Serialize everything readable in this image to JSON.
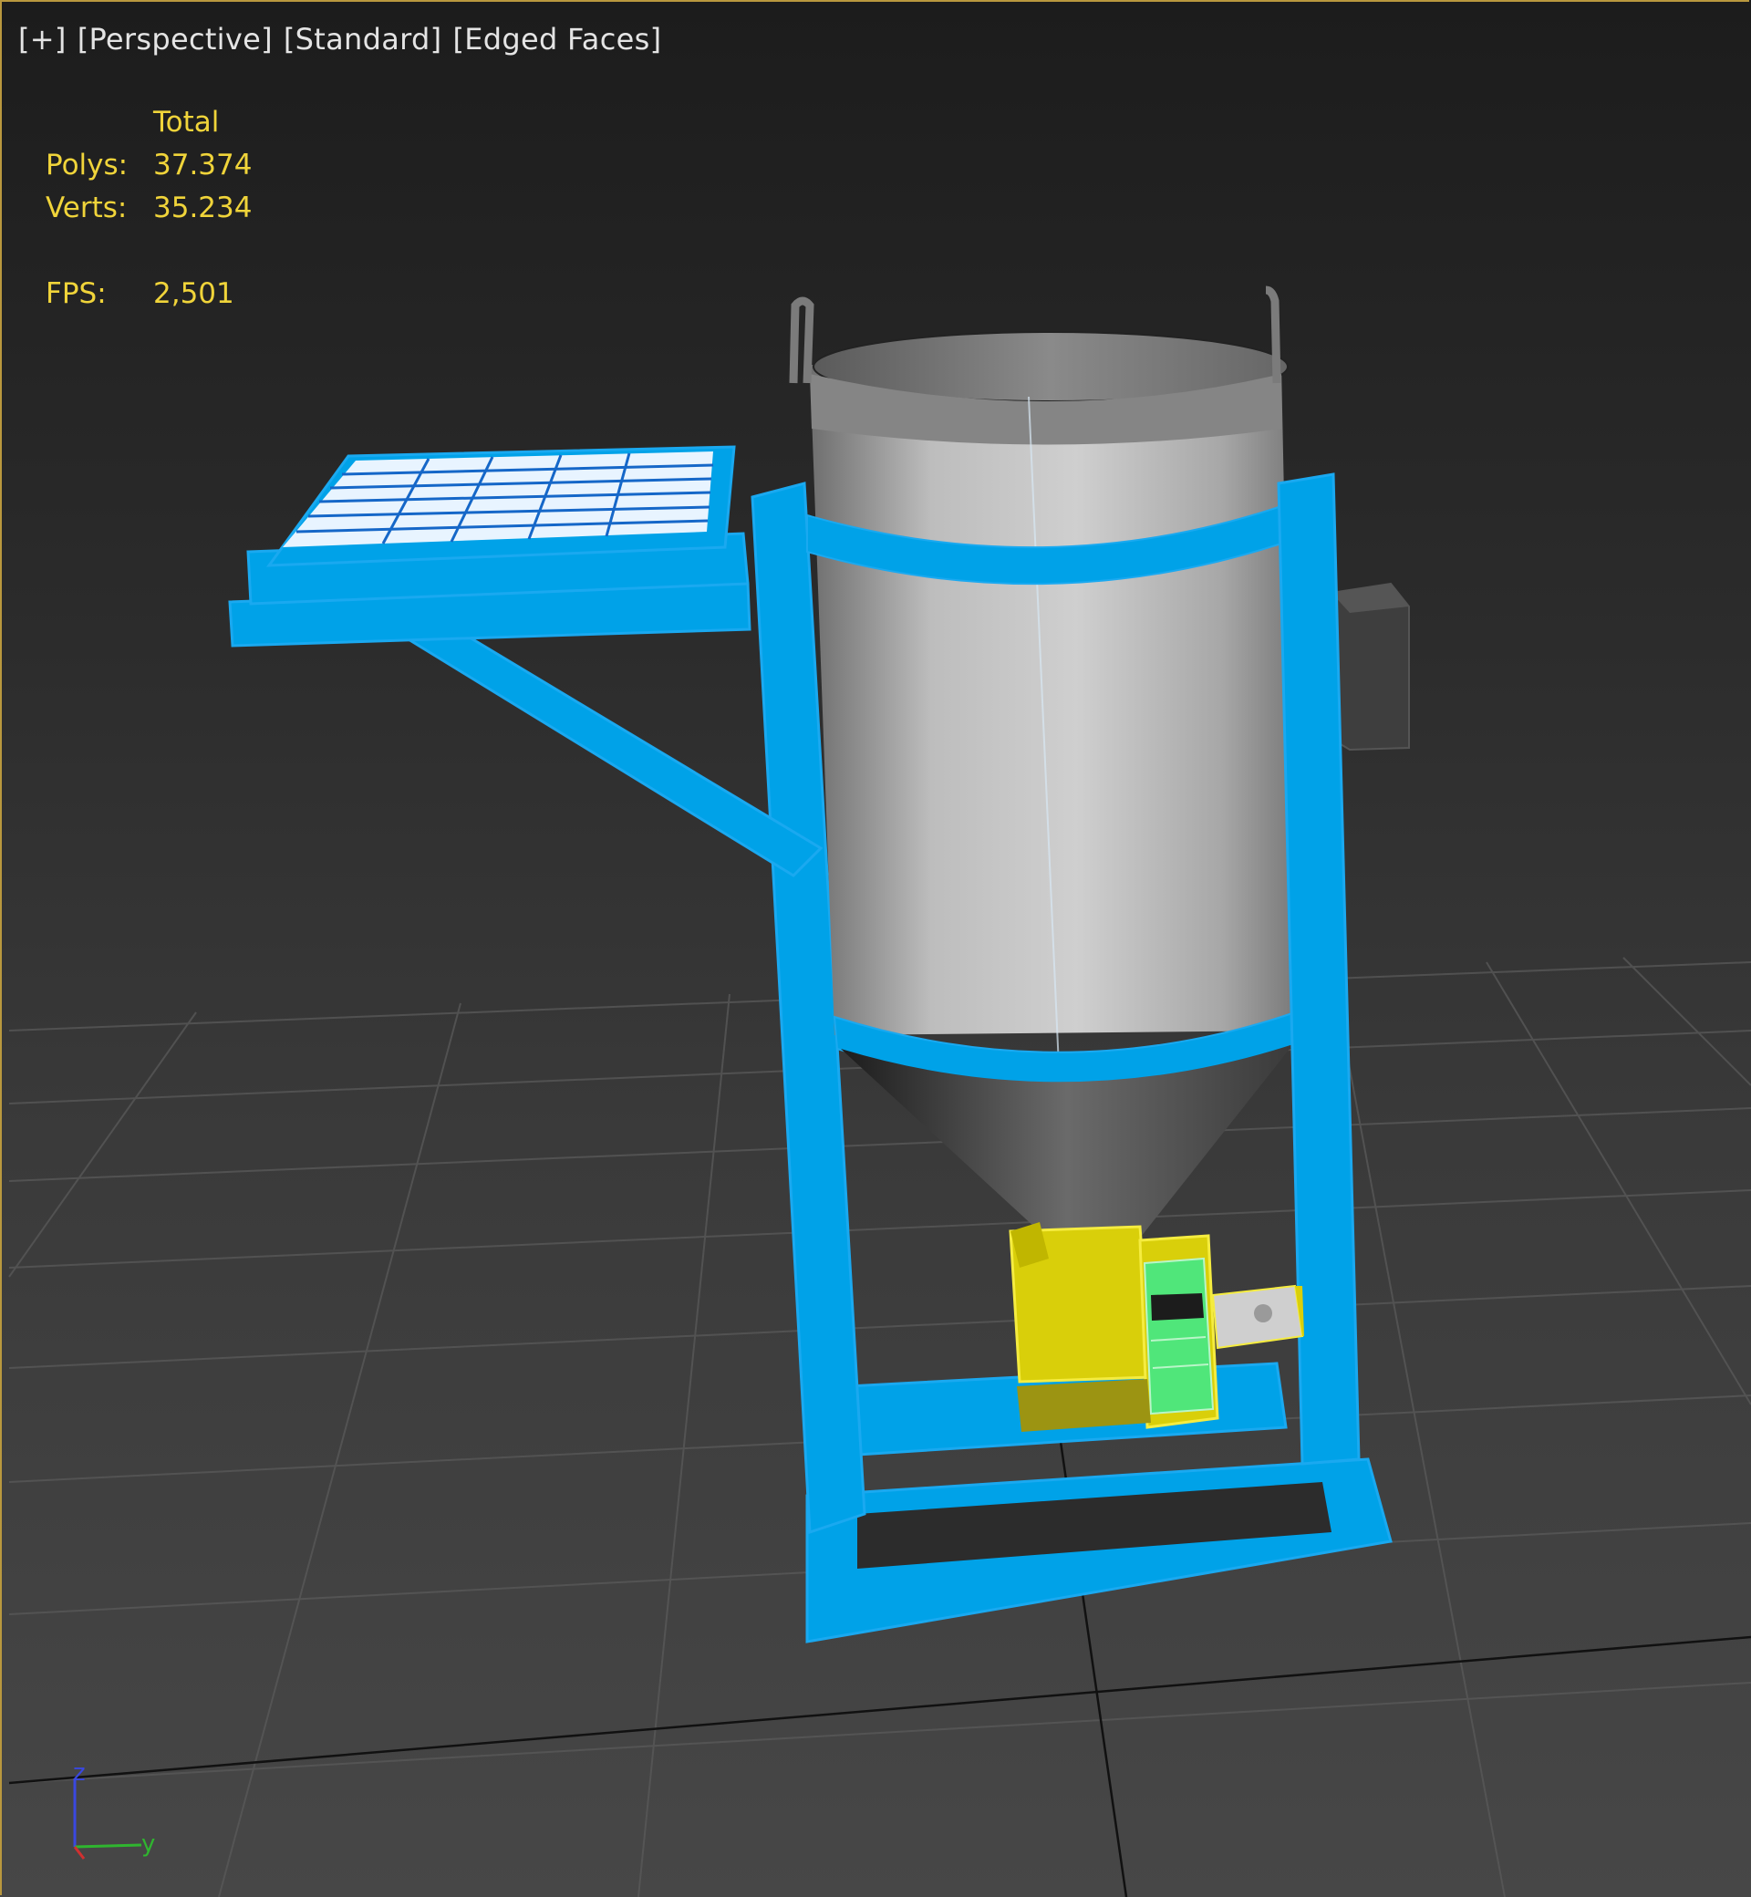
{
  "viewport": {
    "labels": [
      "[+]",
      "[Perspective]",
      "[Standard]",
      "[Edged Faces]"
    ]
  },
  "stats": {
    "header": "Total",
    "polys_label": "Polys:",
    "polys_value": "37.374",
    "verts_label": "Verts:",
    "verts_value": "35.234",
    "fps_label": "FPS:",
    "fps_value": "2,501"
  },
  "axis_gizmo": {
    "z": "z",
    "y": "y"
  },
  "colors": {
    "frame_blue": "#00a2e8",
    "selection_yellow": "#d4c800",
    "motor_green": "#50e67a",
    "tank_grey": "#b8b8b8",
    "stats_yellow": "#f0d43a",
    "viewport_border": "#b9983e"
  }
}
